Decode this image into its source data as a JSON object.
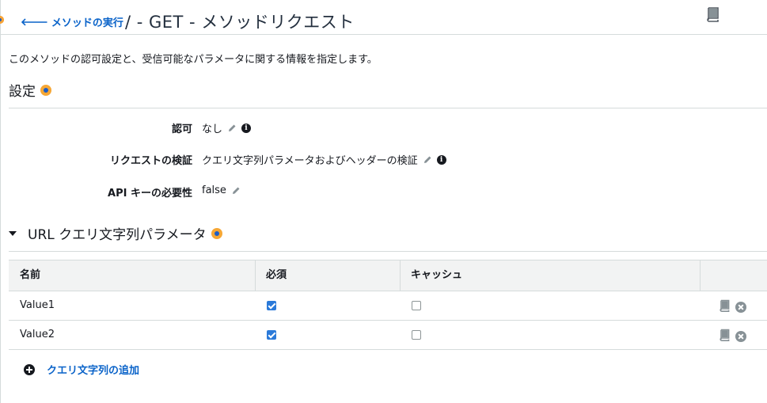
{
  "header": {
    "back_label": "メソッドの実行",
    "title": "/ - GET - メソッドリクエスト"
  },
  "description": "このメソッドの認可設定と、受信可能なパラメータに関する情報を指定します。",
  "settings": {
    "heading": "設定",
    "rows": [
      {
        "label": "認可",
        "value": "なし"
      },
      {
        "label": "リクエストの検証",
        "value": "クエリ文字列パラメータおよびヘッダーの検証"
      },
      {
        "label": "API キーの必要性",
        "value": "false"
      }
    ]
  },
  "url_params": {
    "heading": "URL クエリ文字列パラメータ",
    "columns": [
      "名前",
      "必須",
      "キャッシュ"
    ],
    "rows": [
      {
        "name": "Value1",
        "required": true,
        "cache": false
      },
      {
        "name": "Value2",
        "required": true,
        "cache": false
      }
    ],
    "add_label": "クエリ文字列の追加"
  },
  "colors": {
    "link": "#0a63c9",
    "accent_orange": "#f6a735",
    "checkbox_blue": "#2b7ad9"
  },
  "icons": [
    "arrow-left-icon",
    "book-icon",
    "info-dot-icon",
    "pencil-icon",
    "info-icon",
    "caret-down-icon",
    "close-circle-icon",
    "plus-circle-icon"
  ]
}
